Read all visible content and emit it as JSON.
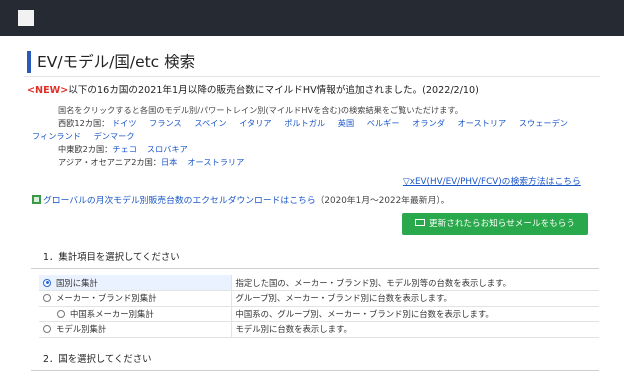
{
  "header": {
    "logo_icon": "site-logo-icon"
  },
  "page": {
    "title": "EV/モデル/国/etc 検索"
  },
  "notice": {
    "badge": "<NEW>",
    "text": "以下の16カ国の2021年1月以降の販売台数にマイルドHV情報が追加されました。(2022/2/10)"
  },
  "description": "国名をクリックすると各国のモデル別/パワートレイン別(マイルドHVを含む)の検索結果をご覧いただけます。",
  "countries": {
    "europe_label": "西欧12カ国：",
    "europe": [
      "ドイツ",
      "フランス",
      "スペイン",
      "イタリア",
      "ポルトガル",
      "英国",
      "ベルギー",
      "オランダ",
      "オーストリア",
      "スウェーデン",
      "フィンランド",
      "デンマーク"
    ],
    "central_label": "中東欧2カ国：",
    "central": [
      "チェコ",
      "スロバキア"
    ],
    "asia_label": "アジア・オセアニア2カ国：",
    "asia": [
      "日本",
      "オーストラリア"
    ]
  },
  "search_help_link": "▽xEV(HV/EV/PHV/FCV)の検索方法はこちら",
  "download": {
    "link": "グローバルの月次モデル別販売台数のエクセルダウンロードはこちら",
    "period": "（2020年1月～2022年最新月）。"
  },
  "mail_button": "更新されたらお知らせメールをもらう",
  "section1": {
    "heading": "1．集計項目を選択してください",
    "options": [
      {
        "label": "国別に集計",
        "desc": "指定した国の、メーカー・ブランド別、モデル別等の台数を表示します。"
      },
      {
        "label": "メーカー・ブランド別集計",
        "desc": "グループ別、メーカー・ブランド別に台数を表示します。"
      },
      {
        "label": "中国系メーカー別集計",
        "desc": "中国系の、グループ別、メーカー・ブランド別に台数を表示します。"
      },
      {
        "label": "モデル別集計",
        "desc": "モデル別に台数を表示します。"
      }
    ]
  },
  "section2": {
    "heading": "2．国を選択してください"
  },
  "colors": {
    "accent": "#2b5bb8",
    "link": "#1a56c9",
    "new_badge": "#e0302a",
    "button": "#29a94b",
    "topbar": "#252a33"
  }
}
